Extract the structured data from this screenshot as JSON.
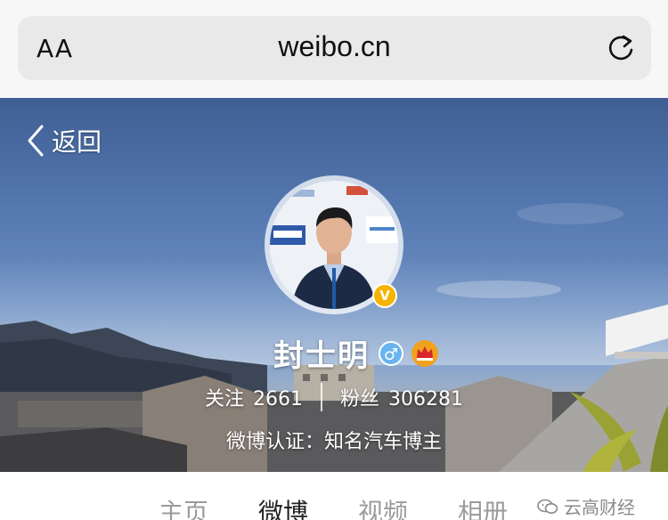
{
  "browser": {
    "text_size_label": "AA",
    "url": "weibo.cn",
    "reload_icon": "reload-icon"
  },
  "header": {
    "back_label": "返回"
  },
  "profile": {
    "name": "封士明",
    "gender_icon": "♂",
    "verified_badge": "V",
    "following_label": "关注",
    "following_count": "2661",
    "followers_label": "粉丝",
    "followers_count": "306281",
    "verification": "微博认证：知名汽车博主"
  },
  "tabs": [
    "主页",
    "微博",
    "视频",
    "相册"
  ],
  "watermark": {
    "text": "云高财经"
  },
  "colors": {
    "sky_top": "#3f5f94",
    "verified_badge": "#f4b400",
    "male_badge": "#69b4f0",
    "crown": "#f0a21e",
    "tab_active": "#222222",
    "tab_inactive": "#9b9b9b"
  }
}
